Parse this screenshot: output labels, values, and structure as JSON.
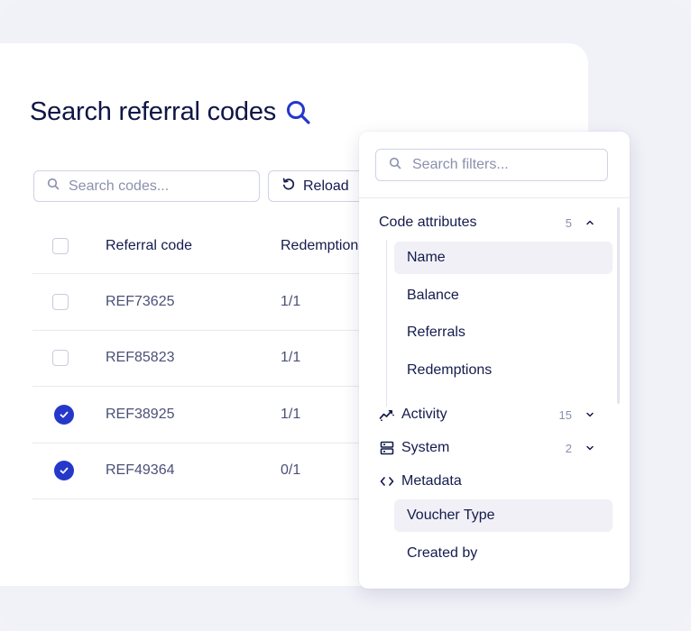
{
  "page": {
    "title": "Search referral codes"
  },
  "toolbar": {
    "search_placeholder": "Search codes...",
    "reload_label": "Reload"
  },
  "table": {
    "columns": [
      "Referral code",
      "Redemption"
    ],
    "rows": [
      {
        "code": "REF73625",
        "redemption": "1/1",
        "checked": false
      },
      {
        "code": "REF85823",
        "redemption": "1/1",
        "checked": false
      },
      {
        "code": "REF38925",
        "redemption": "1/1",
        "checked": true
      },
      {
        "code": "REF49364",
        "redemption": "0/1",
        "checked": true
      }
    ]
  },
  "filters": {
    "search_placeholder": "Search filters...",
    "groups": [
      {
        "label": "Code attributes",
        "count": "5",
        "expanded": true,
        "items": [
          "Name",
          "Balance",
          "Referrals",
          "Redemptions"
        ]
      },
      {
        "label": "Activity",
        "count": "15",
        "expanded": false,
        "icon": "activity-icon"
      },
      {
        "label": "System",
        "count": "2",
        "expanded": false,
        "icon": "server-icon"
      },
      {
        "label": "Metadata",
        "count": "",
        "expanded": true,
        "icon": "code-icon",
        "items": [
          "Voucher Type",
          "Created by"
        ]
      }
    ]
  },
  "colors": {
    "accent": "#2538c9",
    "text": "#141b4d",
    "muted": "#8b90ad"
  }
}
